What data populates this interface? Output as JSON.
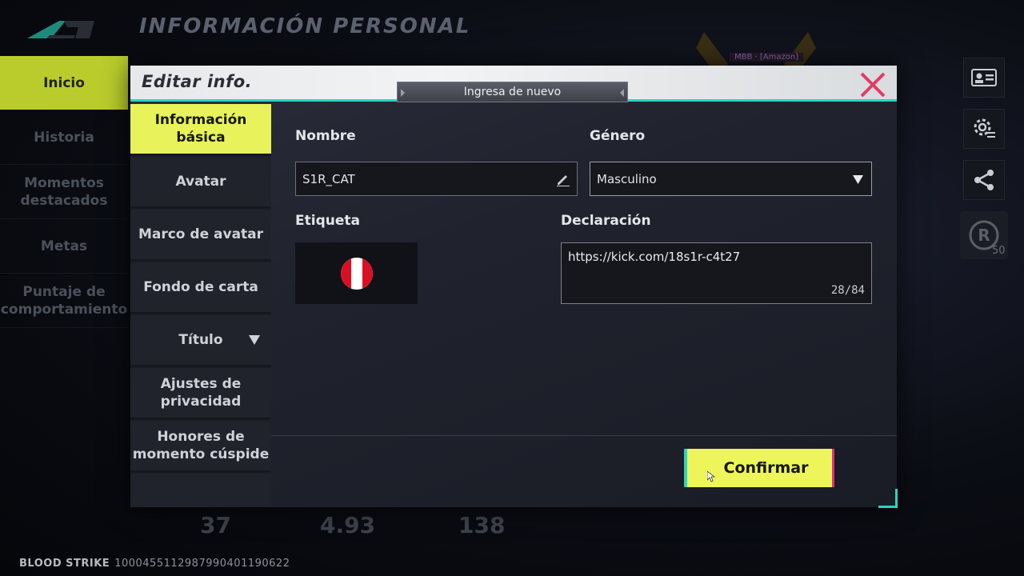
{
  "background": {
    "page_title": "INFORMACIÓN PERSONAL",
    "nav": [
      {
        "label": "Inicio",
        "active": true
      },
      {
        "label": "Historia",
        "active": false
      },
      {
        "label": "Momentos destacados",
        "active": false
      },
      {
        "label": "Metas",
        "active": false
      },
      {
        "label": "Puntaje de comportamiento",
        "active": false
      }
    ],
    "stats": [
      "37",
      "4.93",
      "138"
    ],
    "footer_game": "BLOOD STRIKE",
    "footer_id": "1000455112987990401190622",
    "badge_count": "50",
    "robot_tag": "MBB · [Amazon]",
    "right_icons": [
      "id-card-icon",
      "gear-settings-icon",
      "share-icon",
      "rank-badge-icon"
    ]
  },
  "modal": {
    "title": "Editar info.",
    "relogin_notice": "Ingresa de nuevo",
    "close_icon": "close-x-icon",
    "tabs": [
      {
        "label": "Información básica",
        "active": true
      },
      {
        "label": "Avatar",
        "active": false
      },
      {
        "label": "Marco de avatar",
        "active": false
      },
      {
        "label": "Fondo de carta",
        "active": false
      },
      {
        "label": "Título",
        "active": false,
        "has_dropdown": true
      },
      {
        "label": "Ajustes de privacidad",
        "active": false
      },
      {
        "label": "Honores de momento cúspide",
        "active": false
      }
    ],
    "form": {
      "name_label": "Nombre",
      "name_value": "S1R_CAT",
      "gender_label": "Género",
      "gender_value": "Masculino",
      "tag_label": "Etiqueta",
      "tag_flag": "peru-flag-icon",
      "statement_label": "Declaración",
      "statement_value": "https://kick.com/18s1r-c4t27",
      "statement_count": "28/84"
    },
    "confirm_label": "Confirmar"
  },
  "colors": {
    "accent_yellow": "#e8f25a",
    "accent_cyan": "#28d6c2",
    "accent_pink": "#e0308a",
    "close_red": "#e23c64"
  }
}
